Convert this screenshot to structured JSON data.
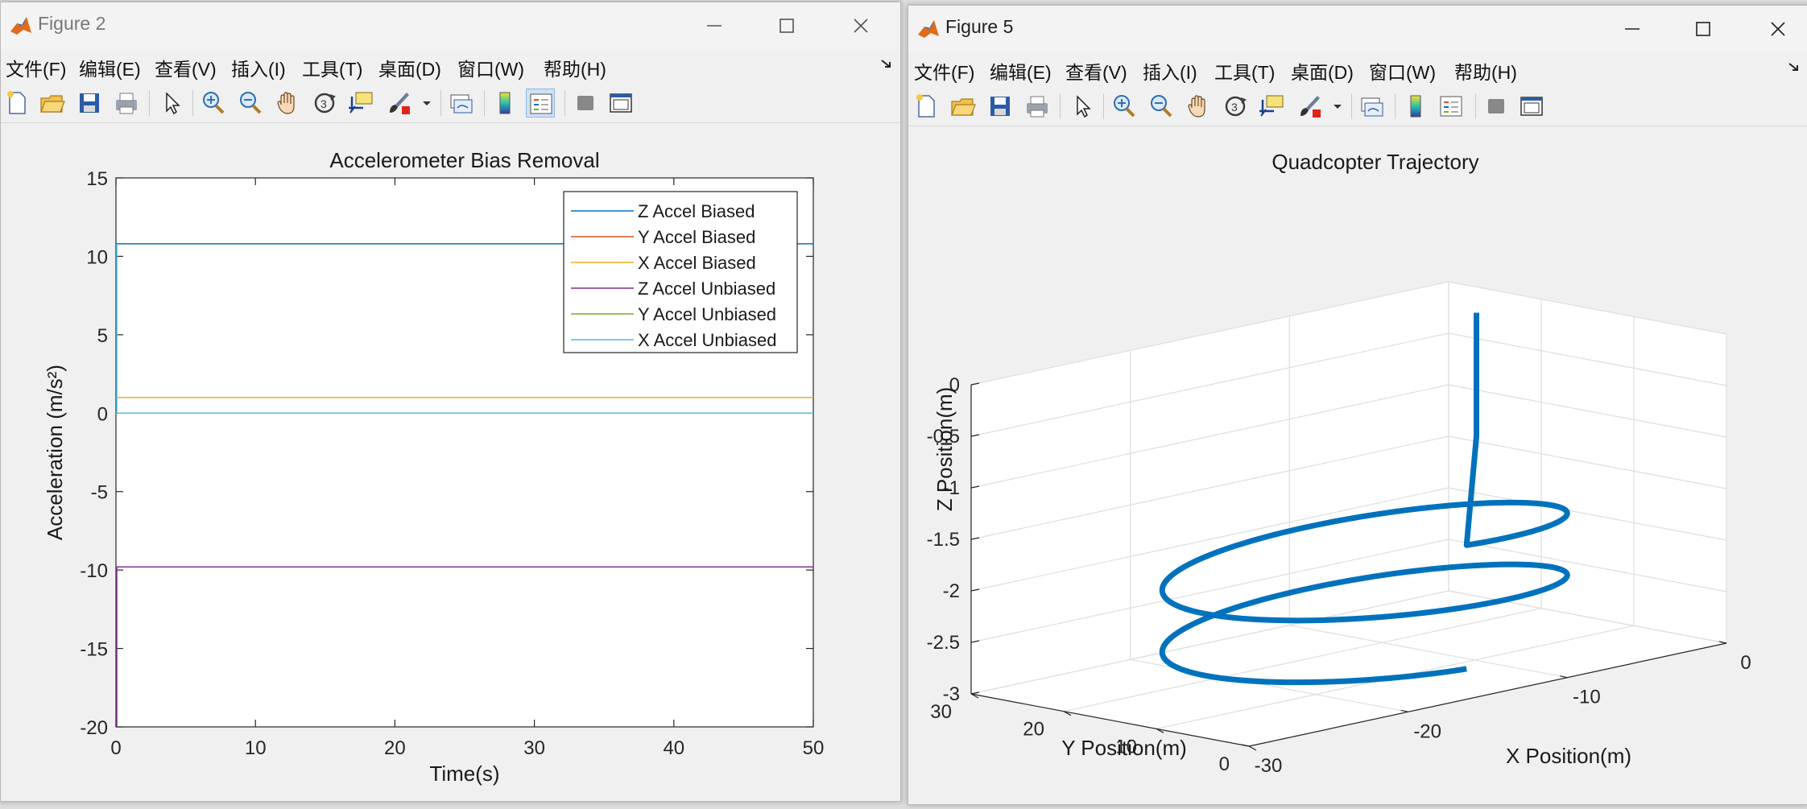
{
  "desktop": {},
  "window_left": {
    "title": "Figure 2",
    "menus": [
      "文件(F)",
      "编辑(E)",
      "查看(V)",
      "插入(I)",
      "工具(T)",
      "桌面(D)",
      "窗口(W)",
      "帮助(H)"
    ],
    "chart_data": {
      "type": "line",
      "title": "Accelerometer Bias Removal",
      "xlabel": "Time(s)",
      "ylabel": "Acceleration (m/s²)",
      "xlim": [
        0,
        50
      ],
      "ylim": [
        -20,
        15
      ],
      "xticks": [
        0,
        10,
        20,
        30,
        40,
        50
      ],
      "yticks": [
        15,
        10,
        5,
        0,
        -5,
        -10,
        -15,
        -20
      ],
      "legend_position": "top-right",
      "grid": false,
      "series": [
        {
          "name": "Z Accel Biased",
          "color": "#0072bd",
          "x": [
            0,
            50
          ],
          "y": [
            10.8,
            10.8
          ]
        },
        {
          "name": "Y Accel Biased",
          "color": "#d95319",
          "x": [
            0,
            50
          ],
          "y": [
            1.0,
            1.0
          ]
        },
        {
          "name": "X Accel Biased",
          "color": "#edb120",
          "x": [
            0,
            50
          ],
          "y": [
            1.0,
            1.0
          ]
        },
        {
          "name": "Z Accel Unbiased",
          "color": "#7e2f8e",
          "x": [
            0,
            50
          ],
          "y": [
            -9.8,
            -9.8
          ]
        },
        {
          "name": "Y Accel Unbiased",
          "color": "#77ac30",
          "x": [
            0,
            50
          ],
          "y": [
            0.0,
            0.0
          ]
        },
        {
          "name": "X Accel Unbiased",
          "color": "#4dbeee",
          "x": [
            0,
            50
          ],
          "y": [
            0.0,
            0.0
          ]
        }
      ]
    }
  },
  "window_right": {
    "title": "Figure 5",
    "menus": [
      "文件(F)",
      "编辑(E)",
      "查看(V)",
      "插入(I)",
      "工具(T)",
      "桌面(D)",
      "窗口(W)",
      "帮助(H)"
    ],
    "chart_data": {
      "type": "line",
      "title": "Quadcopter Trajectory",
      "xlabel": "X Position(m)",
      "ylabel": "Y Position(m)",
      "zlabel": "Z Position(m)",
      "xlim": [
        -30,
        0
      ],
      "ylim": [
        0,
        30
      ],
      "zlim": [
        -3,
        0
      ],
      "xticks": [
        0,
        -10,
        -20,
        -30
      ],
      "yticks": [
        30,
        20,
        10,
        0
      ],
      "zticks": [
        0,
        -0.5,
        -1,
        -1.5,
        -2,
        -2.5,
        -3
      ],
      "grid": true,
      "series": [
        {
          "color": "#0072bd",
          "description": "helical trajectory, two loops"
        }
      ]
    }
  }
}
